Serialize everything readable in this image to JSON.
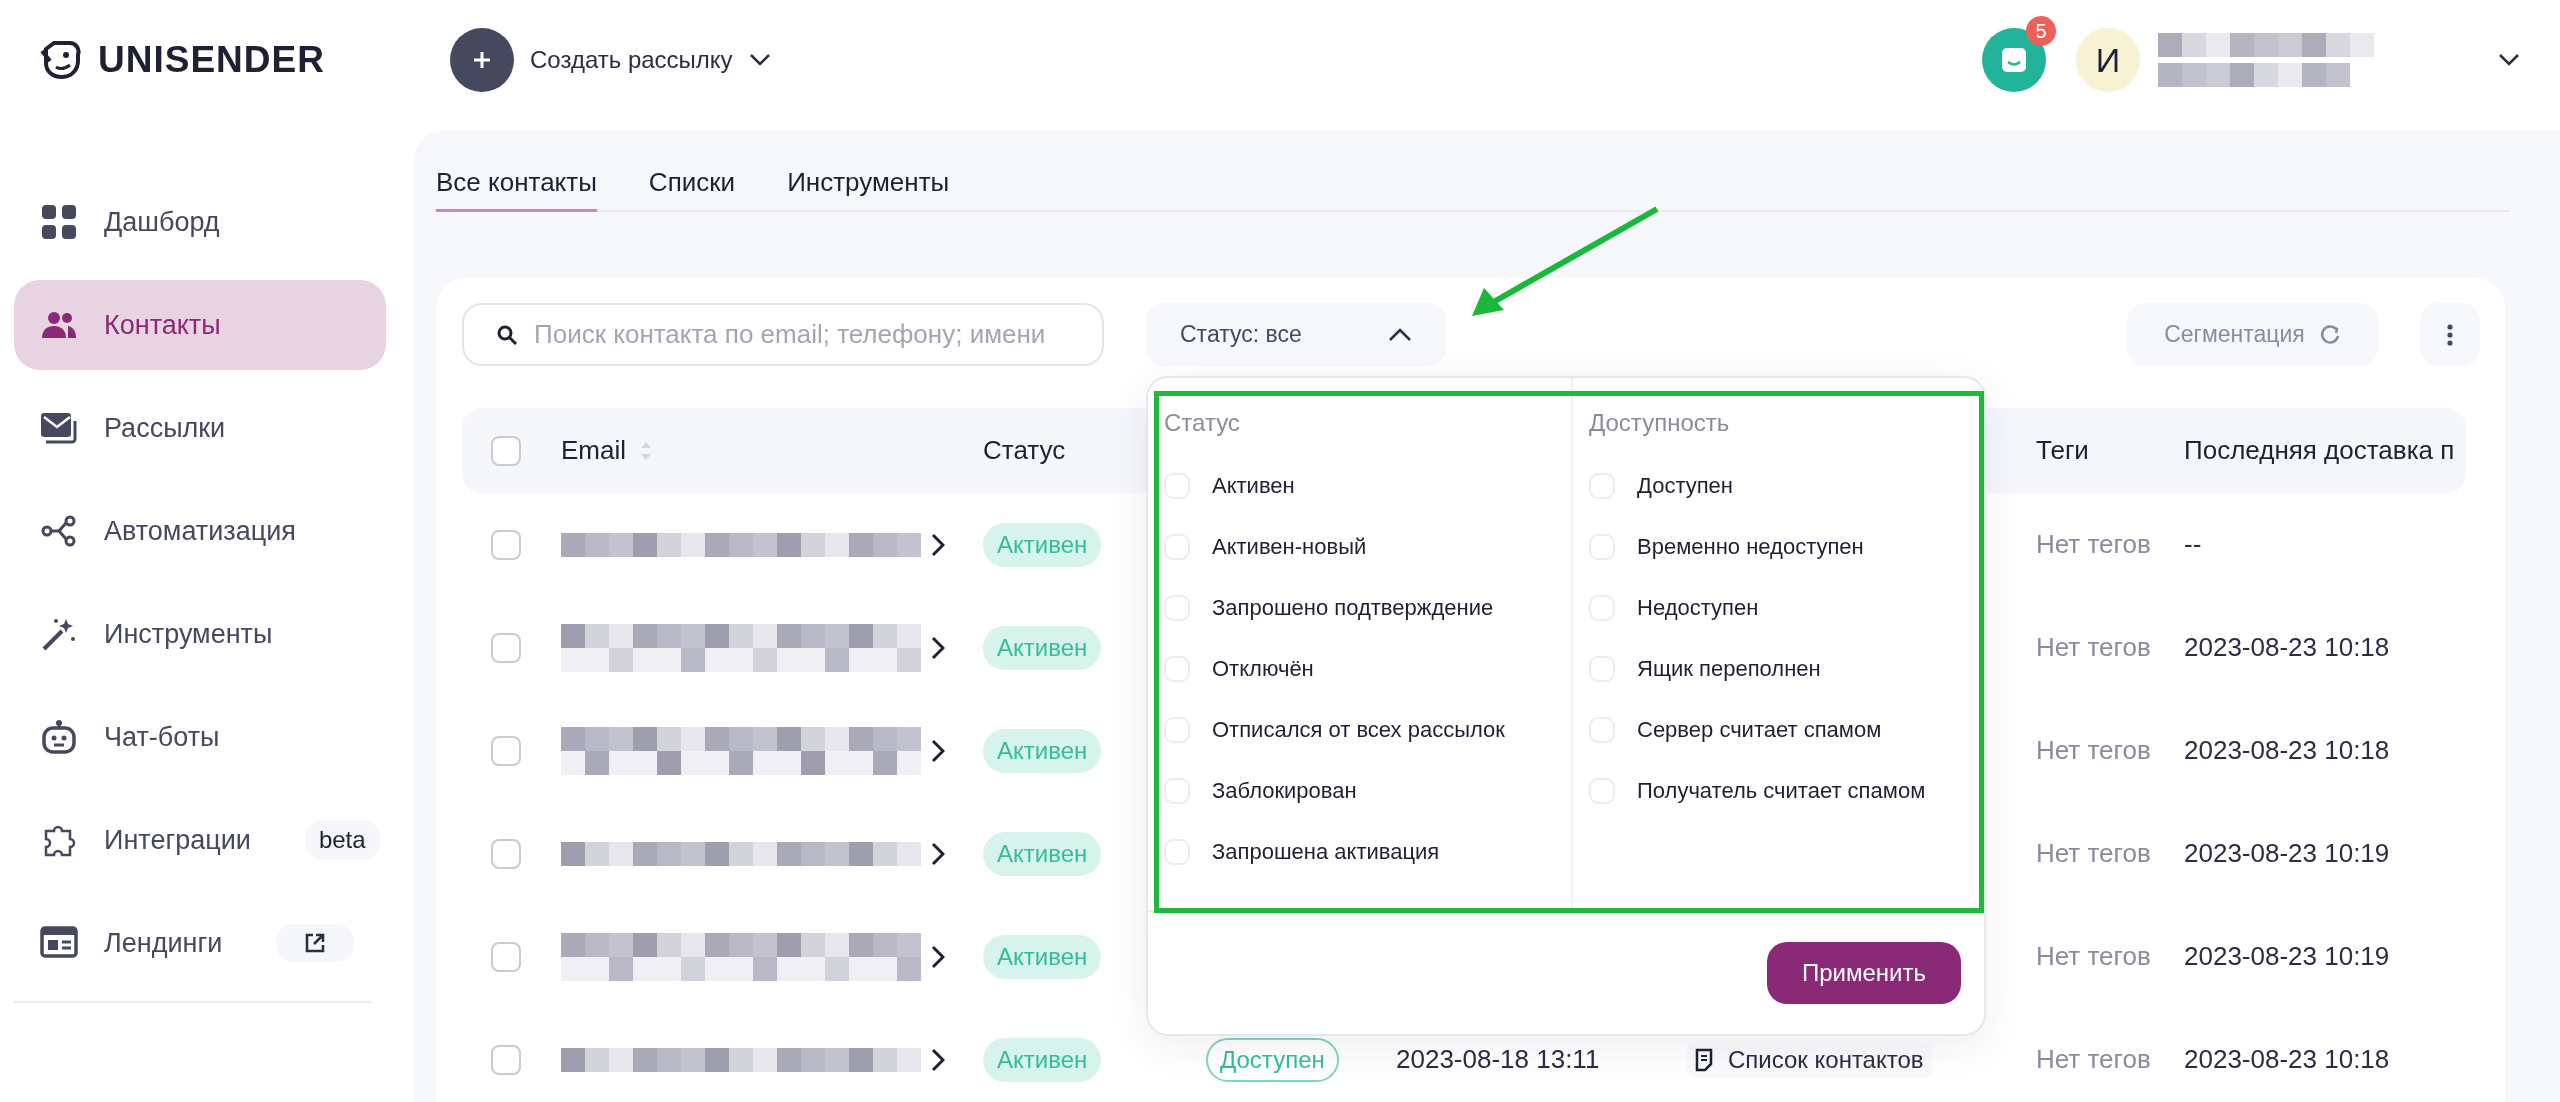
{
  "header": {
    "logo": "UNISENDER",
    "create_button": "Создать рассылку",
    "notifications_count": "5",
    "avatar_initial": "И"
  },
  "sidebar": {
    "items": [
      {
        "label": "Дашборд",
        "selected": false
      },
      {
        "label": "Контакты",
        "selected": true
      },
      {
        "label": "Рассылки",
        "selected": false
      },
      {
        "label": "Автоматизация",
        "selected": false
      },
      {
        "label": "Инструменты",
        "selected": false
      },
      {
        "label": "Чат-боты",
        "selected": false
      },
      {
        "label": "Интеграции",
        "selected": false,
        "badge": "beta"
      },
      {
        "label": "Лендинги",
        "selected": false,
        "external": true
      }
    ]
  },
  "tabs": [
    {
      "label": "Все контакты",
      "selected": true
    },
    {
      "label": "Списки",
      "selected": false
    },
    {
      "label": "Инструменты",
      "selected": false
    }
  ],
  "toolbar": {
    "search": {
      "placeholder": "Поиск контакта по email; телефону; имени"
    },
    "status_filter": {
      "label": "Статус: все",
      "expanded": true
    },
    "segmentation_button": "Сегментация"
  },
  "table": {
    "select_all_checked": false,
    "columns": [
      {
        "label": "Email",
        "sortable": true
      },
      {
        "label": "Статус"
      },
      {
        "label": "Теги"
      },
      {
        "label": "Последняя доставка п"
      }
    ],
    "rows": [
      {
        "checked": false,
        "status": "Активен",
        "tags": "Нет тегов",
        "last_delivery": "--"
      },
      {
        "checked": false,
        "status": "Активен",
        "tags": "Нет тегов",
        "last_delivery": "2023-08-23 10:18"
      },
      {
        "checked": false,
        "status": "Активен",
        "tags": "Нет тегов",
        "last_delivery": "2023-08-23 10:18"
      },
      {
        "checked": false,
        "status": "Активен",
        "tags": "Нет тегов",
        "last_delivery": "2023-08-23 10:19"
      },
      {
        "checked": false,
        "status": "Активен",
        "tags": "Нет тегов",
        "last_delivery": "2023-08-23 10:19"
      },
      {
        "checked": false,
        "status": "Активен",
        "availability": "Доступен",
        "added": "2023-08-18 13:11",
        "list": "Список контактов",
        "tags": "Нет тегов",
        "last_delivery": "2023-08-23 10:18"
      }
    ]
  },
  "filter_dropdown": {
    "groups": [
      {
        "title": "Статус",
        "options": [
          {
            "label": "Активен",
            "checked": false
          },
          {
            "label": "Активен-новый",
            "checked": false
          },
          {
            "label": "Запрошено подтверждение",
            "checked": false
          },
          {
            "label": "Отключён",
            "checked": false
          },
          {
            "label": "Отписался от всех рассылок",
            "checked": false
          },
          {
            "label": "Заблокирован",
            "checked": false
          },
          {
            "label": "Запрошена активация",
            "checked": false
          }
        ]
      },
      {
        "title": "Доступность",
        "options": [
          {
            "label": "Доступен",
            "checked": false
          },
          {
            "label": "Временно недоступен",
            "checked": false
          },
          {
            "label": "Недоступен",
            "checked": false
          },
          {
            "label": "Ящик переполнен",
            "checked": false
          },
          {
            "label": "Сервер считает спамом",
            "checked": false
          },
          {
            "label": "Получатель считает спамом",
            "checked": false
          }
        ]
      }
    ],
    "apply_button": "Применить"
  }
}
